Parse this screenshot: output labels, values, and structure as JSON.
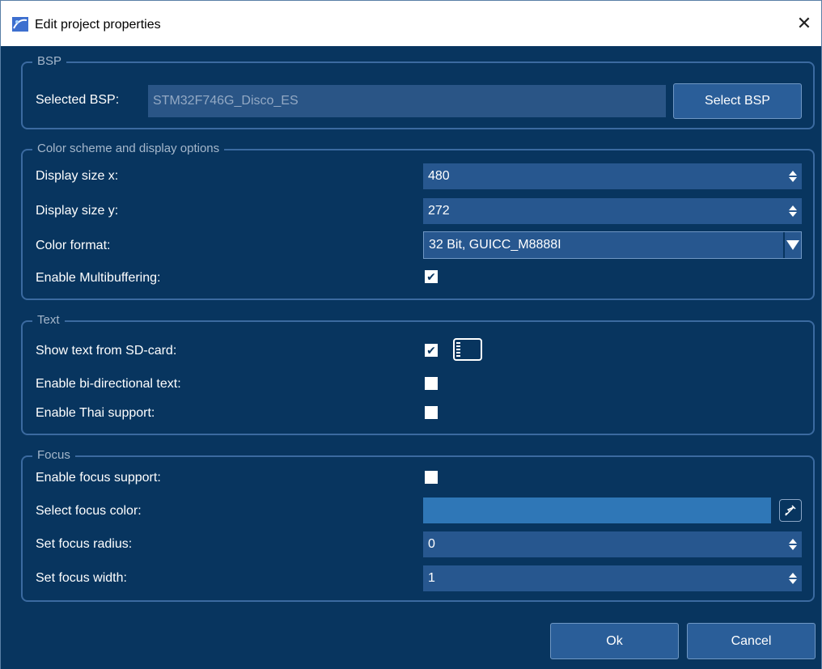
{
  "window": {
    "title": "Edit project properties",
    "close_glyph": "✕"
  },
  "bsp": {
    "group_title": "BSP",
    "label": "Selected BSP:",
    "value": "STM32F746G_Disco_ES",
    "button": "Select BSP"
  },
  "display": {
    "group_title": "Color scheme and display options",
    "size_x_label": "Display size x:",
    "size_x_value": "480",
    "size_y_label": "Display size y:",
    "size_y_value": "272",
    "color_format_label": "Color format:",
    "color_format_value": "32 Bit, GUICC_M8888I",
    "multibuffering_label": "Enable Multibuffering:",
    "multibuffering_checked": true
  },
  "text": {
    "group_title": "Text",
    "sd_label": "Show text from SD-card:",
    "sd_checked": true,
    "sd_icon": "sd-card-icon",
    "bidi_label": "Enable bi-directional text:",
    "bidi_checked": false,
    "thai_label": "Enable Thai support:",
    "thai_checked": false
  },
  "focus": {
    "group_title": "Focus",
    "enable_label": "Enable focus support:",
    "enable_checked": false,
    "color_label": "Select focus color:",
    "color_value": "#2f77b7",
    "picker_icon": "eyedropper-icon",
    "radius_label": "Set focus radius:",
    "radius_value": "0",
    "width_label": "Set focus width:",
    "width_value": "1"
  },
  "buttons": {
    "ok": "Ok",
    "cancel": "Cancel"
  },
  "check_glyph": "✔"
}
